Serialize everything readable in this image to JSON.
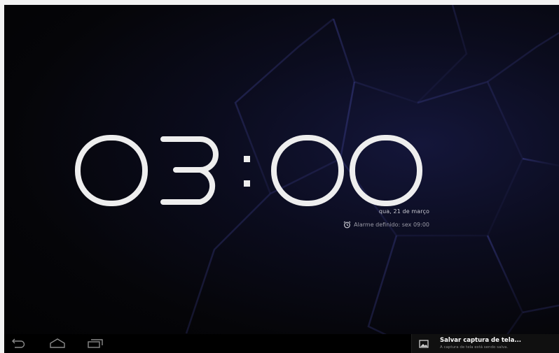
{
  "lockscreen": {
    "time": "03:00",
    "date": "qua, 21 de março",
    "alarm": "Alarme definido: sex 09:00"
  },
  "navbar": {
    "buttons": [
      "back",
      "home",
      "recent-apps"
    ]
  },
  "notification": {
    "title": "Salvar captura de tela...",
    "text": "A captura de tela está sendo salva."
  },
  "colors": {
    "clock_stroke": "#eeeeee",
    "background_dark": "#050508",
    "accent_glow": "#2a2c6a"
  }
}
